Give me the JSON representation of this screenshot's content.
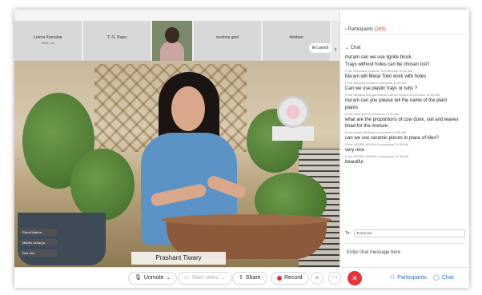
{
  "strip": {
    "tiles": [
      {
        "name": "Leena Karnakar",
        "sub": "Host, me"
      },
      {
        "name": "T. G. Rupa",
        "sub": ""
      },
      {
        "name": "sushma goel",
        "sub": ""
      },
      {
        "name": "Anirban",
        "sub": ""
      }
    ],
    "layout_label": "Layout"
  },
  "video": {
    "speaker_name": "Prashant Tiwary",
    "name_tags": [
      "Shruti Mathur",
      "Madhu Acharya",
      "Ritu Jain"
    ]
  },
  "toolbar": {
    "unmute": "Unmute",
    "start_video": "Start video",
    "share": "Share",
    "record": "Record",
    "participants": "Participants",
    "chat": "Chat"
  },
  "panel": {
    "participants_label": "Participants",
    "participants_count": "(243)",
    "chat_label": "Chat",
    "messages": [
      {
        "from": "",
        "text": "ma'am can we use lignite block"
      },
      {
        "from": "",
        "text": "Trays without holes can be chosen too?"
      },
      {
        "from": "From Dhruvaraj Sharma To Everyone  11:52 AM",
        "text": "Ma'am will Metal Tokri work with holes"
      },
      {
        "from": "From Saumya Gupta to everyone  11:53 AM",
        "text": "Can we use plastic trays or tubs ?"
      },
      {
        "from": "From Nimisha Mongia Mowal Carmel school to everyone  11:54 AM",
        "text": "ma'am can you please tell the name of the plant"
      },
      {
        "from": "",
        "text": "plants"
      },
      {
        "from": "From udita goel to everyone  11:54 AM",
        "text": "what are the proportions of cow dunk, soil and leaves khad for the mixture"
      },
      {
        "from": "From Amshi Sridhari to everyone  11:55 AM",
        "text": "can we use ceramic pieces in place of tiles?"
      },
      {
        "from": "From NEERU ARORA to everyone  11:55 AM",
        "text": "very nice"
      },
      {
        "from": "From NEERU ARORA to everyone  11:55 AM",
        "text": "beautiful"
      }
    ],
    "to_label": "To:",
    "to_value": "Everyone",
    "input_placeholder": "Enter chat message here"
  }
}
